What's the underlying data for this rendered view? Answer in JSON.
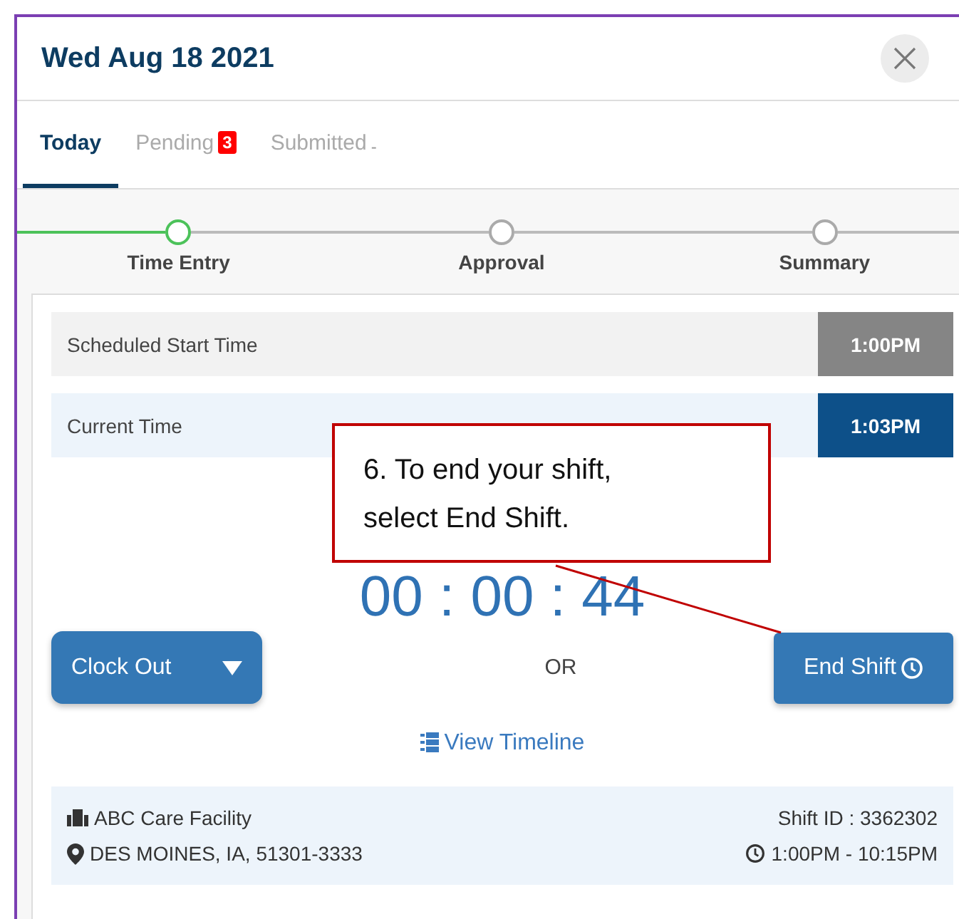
{
  "dialog": {
    "title": "Wed Aug 18 2021"
  },
  "tabs": [
    {
      "label": "Today",
      "selected": true
    },
    {
      "label": "Pending",
      "badge": "3",
      "selected": false
    },
    {
      "label": "Submitted",
      "badge": "-",
      "selected": false
    }
  ],
  "steps": [
    {
      "label": "Time Entry",
      "active": true
    },
    {
      "label": "Approval",
      "active": false
    },
    {
      "label": "Summary",
      "active": false
    }
  ],
  "time_rows": [
    {
      "label": "Scheduled Start Time",
      "value": "1:00PM",
      "kind": "scheduled"
    },
    {
      "label": "Current Time",
      "value": "1:03PM",
      "kind": "current"
    }
  ],
  "timer": {
    "value": "00 : 00 : 44"
  },
  "actions": {
    "clock_out": "Clock Out",
    "separator": "OR",
    "end_shift": "End Shift",
    "view_timeline": "View Timeline"
  },
  "shift_info": {
    "facility": "ABC Care Facility",
    "address": "DES MOINES, IA, 51301-3333",
    "shift_id": "Shift ID : 3362302",
    "hours": "1:00PM - 10:15PM"
  },
  "callout": {
    "text": "6. To end your shift, select End Shift."
  }
}
